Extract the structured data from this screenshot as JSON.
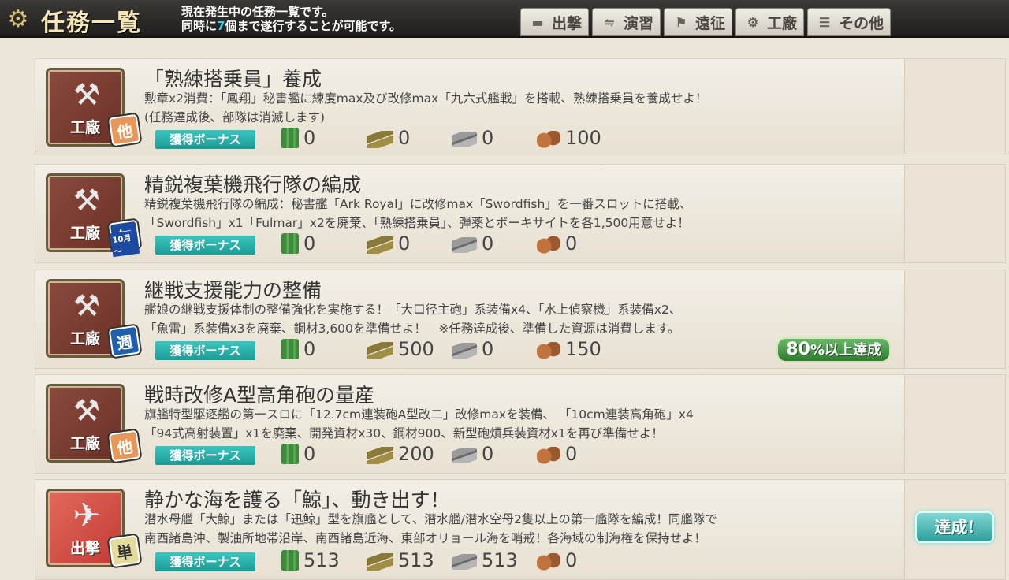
{
  "header": {
    "title": "任務一覧",
    "desc_line1": "現在発生中の任務一覧です。",
    "desc_line2_a": "同時に",
    "desc_line2_num": "7",
    "desc_line2_b": "個まで遂行することが可能です。"
  },
  "nav": [
    {
      "label": "出撃",
      "icon": "fleet-icon"
    },
    {
      "label": "演習",
      "icon": "exercise-icon"
    },
    {
      "label": "遠征",
      "icon": "expedition-icon"
    },
    {
      "label": "工廠",
      "icon": "arsenal-icon"
    },
    {
      "label": "その他",
      "icon": "other-icon"
    }
  ],
  "bonus_label": "獲得ボーナス",
  "quests": [
    {
      "category": "工廠",
      "freq": "他",
      "title": "「熟練搭乗員」養成",
      "desc1": "勲章x2消費：「鳳翔」秘書艦に練度max及び改修max「九六式艦戦」を搭載、熟練搭乗員を養成せよ！",
      "desc2": "(任務達成後、部隊は消滅します)",
      "fuel": "0",
      "ammo": "0",
      "steel": "0",
      "bauxite": "100"
    },
    {
      "category": "工廠",
      "freq": "年",
      "freq_sub": "10月～",
      "title": "精鋭複葉機飛行隊の編成",
      "desc1": "精鋭複葉機飛行隊の編成：秘書艦「Ark Royal」に改修max「Swordfish」を一番スロットに搭載、",
      "desc2": "「Swordfish」x1「Fulmar」x2を廃棄、「熟練搭乗員」、弾薬とボーキサイトを各1,500用意せよ！",
      "fuel": "0",
      "ammo": "0",
      "steel": "0",
      "bauxite": "0"
    },
    {
      "category": "工廠",
      "freq": "週",
      "title": "継戦支援能力の整備",
      "desc1": "艦娘の継戦支援体制の整備強化を実施する！「大口径主砲」系装備x4、「水上偵察機」系装備x2、",
      "desc2": "「魚雷」系装備x3を廃棄、鋼材3,600を準備せよ！　※任務達成後、準備した資源は消費します。",
      "fuel": "0",
      "ammo": "500",
      "steel": "0",
      "bauxite": "150",
      "progress_num": "80",
      "progress_text": "%以上達成"
    },
    {
      "category": "工廠",
      "freq": "他",
      "title": "戦時改修A型高角砲の量産",
      "desc1": "旗艦特型駆逐艦の第一スロに「12.7cm連装砲A型改二」改修maxを装備、 「10cm連装高角砲」x4",
      "desc2": "「94式高射装置」x1を廃棄、開発資材x30、鋼材900、新型砲熕兵装資材x1を再び準備せよ！",
      "fuel": "0",
      "ammo": "200",
      "steel": "0",
      "bauxite": "0"
    },
    {
      "category": "出撃",
      "freq": "単",
      "title": "静かな海を護る「鯨」、動き出す！",
      "desc1": "潜水母艦「大鯨」または「迅鯨」型を旗艦として、潜水艦/潜水空母2隻以上の第一艦隊を編成！同艦隊で",
      "desc2": "南西諸島沖、製油所地帯沿岸、南西諸島近海、東部オリョール海を哨戒！各海域の制海権を保持せよ！",
      "fuel": "513",
      "ammo": "513",
      "steel": "513",
      "bauxite": "0",
      "done_label": "達成!"
    }
  ],
  "colors": {
    "bonus_tag": "#1e9b96",
    "arsenal_icon": "#6a3026",
    "sortie_icon": "#c23a34",
    "highlight": "#35d0e8"
  }
}
